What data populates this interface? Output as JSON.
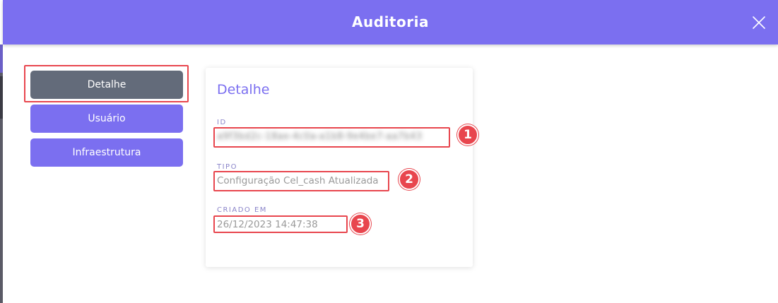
{
  "header": {
    "title": "Auditoria"
  },
  "nav": {
    "items": [
      {
        "label": "Detalhe",
        "active": true
      },
      {
        "label": "Usuário",
        "active": false
      },
      {
        "label": "Infraestrutura",
        "active": false
      }
    ]
  },
  "card": {
    "title": "Detalhe",
    "fields": [
      {
        "label": "ID",
        "value": "a9f3bd2c-18ae-4c0a-a1b8-9e4be7-aa7b43"
      },
      {
        "label": "TIPO",
        "value": "Configuração Cel_cash Atualizada"
      },
      {
        "label": "CRIADO EM",
        "value": "26/12/2023 14:47:38"
      }
    ]
  },
  "annotations": [
    "1",
    "2",
    "3"
  ],
  "colors": {
    "accent": "#7b6ff0",
    "active_nav": "#636b7a",
    "highlight": "#e8464e"
  }
}
